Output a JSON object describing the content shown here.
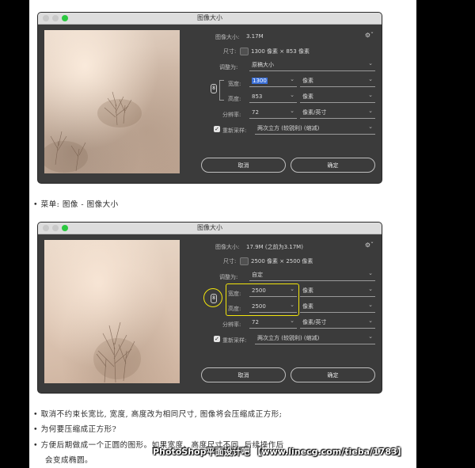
{
  "dialog1": {
    "title": "图像大小",
    "image_size_label": "图像大小:",
    "image_size_value": "3.17M",
    "dimensions_label": "尺寸:",
    "dimensions_value": "1300 像素 × 853 像素",
    "fit_label": "调整为:",
    "fit_value": "原稿大小",
    "width_label": "宽度:",
    "width_value": "1300",
    "width_unit": "像素",
    "height_label": "高度:",
    "height_value": "853",
    "height_unit": "像素",
    "resolution_label": "分辨率:",
    "resolution_value": "72",
    "resolution_unit": "像素/英寸",
    "resample_label": "重新采样:",
    "resample_value": "两次立方 (较锐利) (缩减)",
    "cancel": "取消",
    "ok": "确定"
  },
  "note1": "• 菜单: 图像 - 图像大小",
  "dialog2": {
    "title": "图像大小",
    "image_size_label": "图像大小:",
    "image_size_value": "17.9M (之前为3.17M)",
    "dimensions_label": "尺寸:",
    "dimensions_value": "2500 像素 × 2500 像素",
    "fit_label": "调整为:",
    "fit_value": "自定",
    "width_label": "宽度:",
    "width_value": "2500",
    "width_unit": "像素",
    "height_label": "高度:",
    "height_value": "2500",
    "height_unit": "像素",
    "resolution_label": "分辨率:",
    "resolution_value": "72",
    "resolution_unit": "像素/英寸",
    "resample_label": "重新采样:",
    "resample_value": "两次立方 (较锐利) (缩减)",
    "cancel": "取消",
    "ok": "确定"
  },
  "notes": [
    "• 取消不约束长宽比, 宽度, 高度改为相同尺寸, 图像将会压缩成正方形;",
    "• 为何要压缩成正方形?",
    "• 方便后期做成一个正圆的图形。如果宽度、高度尺寸不同, 后续操作后",
    "会变成椭圆。"
  ],
  "watermark": "PhotoShop平面设计吧 【www.linecg.com/tieba/1783】",
  "icons": {
    "gear": "gear-icon",
    "link": "link-chain-icon",
    "checkbox": "checkmark-icon"
  },
  "colors": {
    "dialog_bg": "#3b3b3b",
    "highlight": "#f3e60c",
    "selection": "#3a6fd8"
  }
}
